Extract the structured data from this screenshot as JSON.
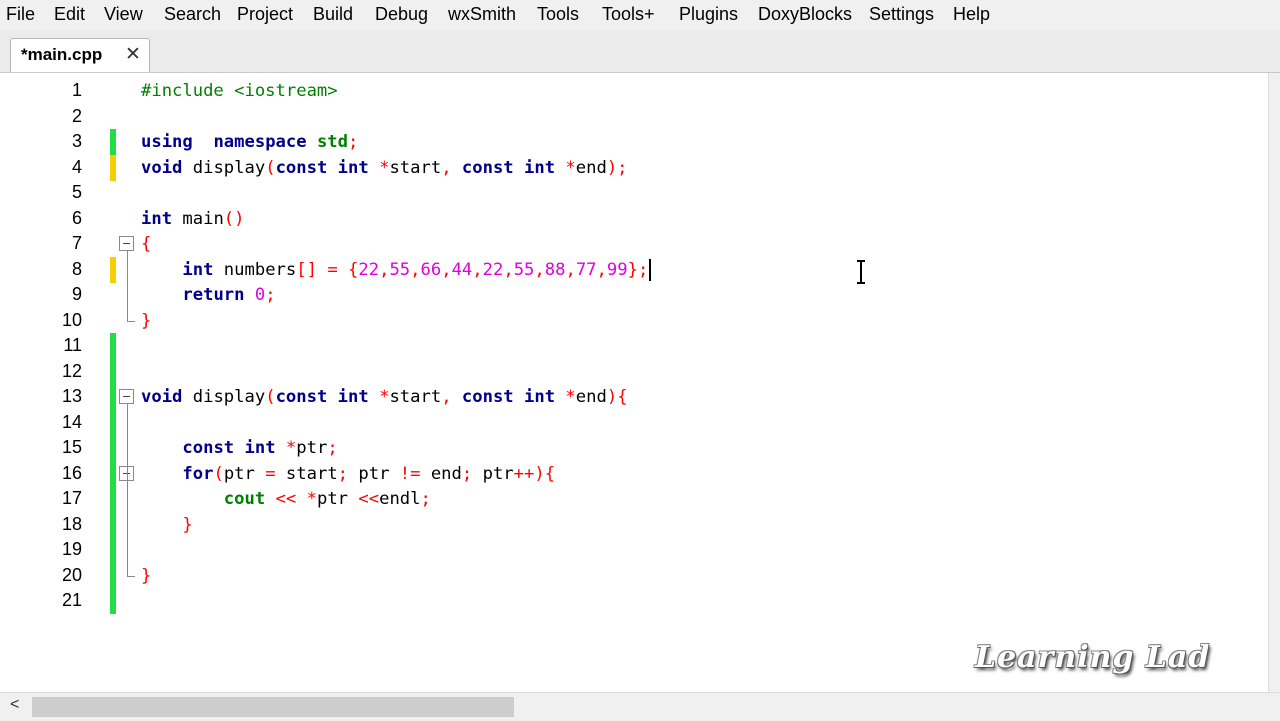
{
  "menubar": {
    "items": [
      "File",
      "Edit",
      "View",
      "Search",
      "Project",
      "Build",
      "Debug",
      "wxSmith",
      "Tools",
      "Tools+",
      "Plugins",
      "DoxyBlocks",
      "Settings",
      "Help"
    ]
  },
  "tabs": [
    {
      "label": "*main.cpp",
      "close": "✕"
    }
  ],
  "editor": {
    "lines": [
      {
        "n": "1",
        "mark": "",
        "tokens": [
          [
            "pp",
            "#include <iostream>"
          ]
        ]
      },
      {
        "n": "2",
        "mark": "",
        "tokens": []
      },
      {
        "n": "3",
        "mark": "saved",
        "tokens": [
          [
            "kw",
            "using"
          ],
          [
            "",
            "  "
          ],
          [
            "kw",
            "namespace"
          ],
          [
            "",
            " "
          ],
          [
            "kw2",
            "std"
          ],
          [
            "op",
            ";"
          ]
        ]
      },
      {
        "n": "4",
        "mark": "modified",
        "tokens": [
          [
            "kw",
            "void"
          ],
          [
            "",
            " display"
          ],
          [
            "op",
            "("
          ],
          [
            "kw",
            "const"
          ],
          [
            "",
            " "
          ],
          [
            "kw",
            "int"
          ],
          [
            "",
            " "
          ],
          [
            "op",
            "*"
          ],
          [
            "",
            "start"
          ],
          [
            "op",
            ","
          ],
          [
            "",
            " "
          ],
          [
            "kw",
            "const"
          ],
          [
            "",
            " "
          ],
          [
            "kw",
            "int"
          ],
          [
            "",
            " "
          ],
          [
            "op",
            "*"
          ],
          [
            "",
            "end"
          ],
          [
            "op",
            ");"
          ]
        ]
      },
      {
        "n": "5",
        "mark": "",
        "tokens": []
      },
      {
        "n": "6",
        "mark": "",
        "tokens": [
          [
            "kw",
            "int"
          ],
          [
            "",
            " main"
          ],
          [
            "op",
            "()"
          ]
        ]
      },
      {
        "n": "7",
        "mark": "",
        "tokens": [
          [
            "op",
            "{"
          ]
        ]
      },
      {
        "n": "8",
        "mark": "modified",
        "tokens": [
          [
            "",
            "    "
          ],
          [
            "kw",
            "int"
          ],
          [
            "",
            " numbers"
          ],
          [
            "op",
            "[]"
          ],
          [
            "",
            " "
          ],
          [
            "op",
            "="
          ],
          [
            "",
            " "
          ],
          [
            "op",
            "{"
          ],
          [
            "num",
            "22"
          ],
          [
            "op",
            ","
          ],
          [
            "num",
            "55"
          ],
          [
            "op",
            ","
          ],
          [
            "num",
            "66"
          ],
          [
            "op",
            ","
          ],
          [
            "num",
            "44"
          ],
          [
            "op",
            ","
          ],
          [
            "num",
            "22"
          ],
          [
            "op",
            ","
          ],
          [
            "num",
            "55"
          ],
          [
            "op",
            ","
          ],
          [
            "num",
            "88"
          ],
          [
            "op",
            ","
          ],
          [
            "num",
            "77"
          ],
          [
            "op",
            ","
          ],
          [
            "num",
            "99"
          ],
          [
            "op",
            "};"
          ]
        ]
      },
      {
        "n": "9",
        "mark": "",
        "tokens": [
          [
            "",
            "    "
          ],
          [
            "kw",
            "return"
          ],
          [
            "",
            " "
          ],
          [
            "num",
            "0"
          ],
          [
            "op",
            ";"
          ]
        ]
      },
      {
        "n": "10",
        "mark": "",
        "tokens": [
          [
            "op",
            "}"
          ]
        ]
      },
      {
        "n": "11",
        "mark": "saved",
        "tokens": []
      },
      {
        "n": "12",
        "mark": "saved",
        "tokens": []
      },
      {
        "n": "13",
        "mark": "saved",
        "tokens": [
          [
            "kw",
            "void"
          ],
          [
            "",
            " display"
          ],
          [
            "op",
            "("
          ],
          [
            "kw",
            "const"
          ],
          [
            "",
            " "
          ],
          [
            "kw",
            "int"
          ],
          [
            "",
            " "
          ],
          [
            "op",
            "*"
          ],
          [
            "",
            "start"
          ],
          [
            "op",
            ","
          ],
          [
            "",
            " "
          ],
          [
            "kw",
            "const"
          ],
          [
            "",
            " "
          ],
          [
            "kw",
            "int"
          ],
          [
            "",
            " "
          ],
          [
            "op",
            "*"
          ],
          [
            "",
            "end"
          ],
          [
            "op",
            ")"
          ],
          [
            "op",
            "{"
          ]
        ]
      },
      {
        "n": "14",
        "mark": "saved",
        "tokens": []
      },
      {
        "n": "15",
        "mark": "saved",
        "tokens": [
          [
            "",
            "    "
          ],
          [
            "kw",
            "const"
          ],
          [
            "",
            " "
          ],
          [
            "kw",
            "int"
          ],
          [
            "",
            " "
          ],
          [
            "op",
            "*"
          ],
          [
            "",
            "ptr"
          ],
          [
            "op",
            ";"
          ]
        ]
      },
      {
        "n": "16",
        "mark": "saved",
        "tokens": [
          [
            "",
            "    "
          ],
          [
            "kw",
            "for"
          ],
          [
            "op",
            "("
          ],
          [
            "",
            "ptr "
          ],
          [
            "op",
            "="
          ],
          [
            "",
            " start"
          ],
          [
            "op",
            ";"
          ],
          [
            "",
            " ptr "
          ],
          [
            "op",
            "!="
          ],
          [
            "",
            " end"
          ],
          [
            "op",
            ";"
          ],
          [
            "",
            " ptr"
          ],
          [
            "op",
            "++"
          ],
          [
            "op",
            ")"
          ],
          [
            "op",
            "{"
          ]
        ]
      },
      {
        "n": "17",
        "mark": "saved",
        "tokens": [
          [
            "",
            "        "
          ],
          [
            "kw2",
            "cout"
          ],
          [
            "",
            " "
          ],
          [
            "op",
            "<<"
          ],
          [
            "",
            " "
          ],
          [
            "op",
            "*"
          ],
          [
            "",
            "ptr "
          ],
          [
            "op",
            "<<"
          ],
          [
            "",
            "endl"
          ],
          [
            "op",
            ";"
          ]
        ]
      },
      {
        "n": "18",
        "mark": "saved",
        "tokens": [
          [
            "",
            "    "
          ],
          [
            "op",
            "}"
          ]
        ]
      },
      {
        "n": "19",
        "mark": "saved",
        "tokens": []
      },
      {
        "n": "20",
        "mark": "saved",
        "tokens": [
          [
            "op",
            "}"
          ]
        ]
      },
      {
        "n": "21",
        "mark": "saved",
        "tokens": []
      }
    ]
  },
  "colors": {
    "keyword": "#00008b",
    "stdlib": "#008000",
    "preprocessor": "#008000",
    "operator": "#ff0000",
    "number": "#e000e0",
    "saved_marker": "#22dd44",
    "modified_marker": "#f5d000"
  },
  "icons": {
    "fold": "fold-minus-icon",
    "scroll_left": "chevron-left-icon",
    "cursor": "text-cursor-icon"
  },
  "watermark": "Learning Lad",
  "hscroll": {
    "left_arrow": "<"
  }
}
